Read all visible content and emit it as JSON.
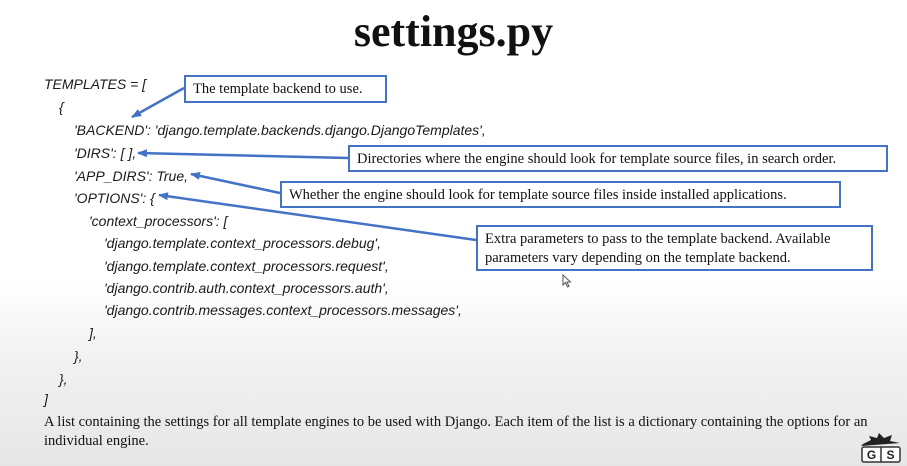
{
  "title": "settings.py",
  "code_lines": [
    "TEMPLATES = [",
    "{",
    "'BACKEND': 'django.template.backends.django.DjangoTemplates',",
    "'DIRS': [ ],",
    "'APP_DIRS': True,",
    "'OPTIONS': {",
    "'context_processors': [",
    "'django.template.context_processors.debug',",
    "'django.template.context_processors.request',",
    "'django.contrib.auth.context_processors.auth',",
    "'django.contrib.messages.context_processors.messages',",
    "],",
    "},",
    "},",
    "]"
  ],
  "callouts": {
    "backend": "The template backend to use.",
    "dirs": "Directories where the engine should look for template source files, in search order.",
    "app_dirs": "Whether the engine should look for template source files inside installed applications.",
    "options": "Extra parameters to pass to the template backend. Available parameters vary depending on the template backend."
  },
  "caption": "A list containing the settings for all template engines to be used with Django. Each item of the list is a dictionary containing the options for an individual engine.",
  "logo": "GS",
  "colors": {
    "callout_border": "#4472c4",
    "arrow": "#4472c4"
  }
}
